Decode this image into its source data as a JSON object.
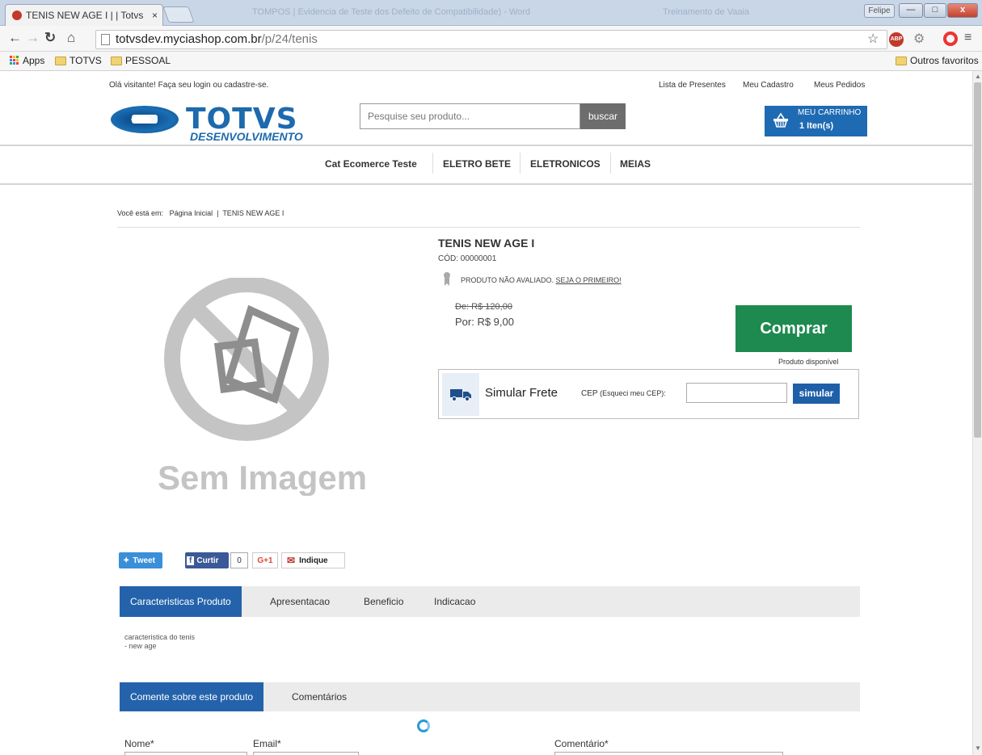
{
  "browser": {
    "tab_title": "TENIS NEW AGE I | | Totvs",
    "tab_close": "×",
    "bg_title_1": "TOMPOS | Evidencia de Teste dos Defeito de Compatibilidade) - Word",
    "bg_title_2": "Treinamento de Vaaia",
    "user_badge": "Felipe",
    "url_host": "totvsdev.myciashop.com.br",
    "url_path": "/p/24/tenis",
    "abp": "ABP"
  },
  "bookmarks": {
    "apps": "Apps",
    "items": [
      "TOTVS",
      "PESSOAL"
    ],
    "others": "Outros favoritos"
  },
  "header": {
    "welcome": "Olá visitante! Faça seu login ou cadastre-se.",
    "links": [
      "Lista de Presentes",
      "Meu Cadastro",
      "Meus Pedidos"
    ],
    "logo_text": "TOTVS",
    "logo_sub": "DESENVOLVIMENTO",
    "search_placeholder": "Pesquise seu produto...",
    "search_button": "buscar",
    "cart_label": "MEU CARRINHO",
    "cart_count": "1 Iten(s)"
  },
  "nav": {
    "items": [
      "Cat Ecomerce Teste",
      "ELETRO BETE",
      "ELETRONICOS",
      "MEIAS"
    ]
  },
  "breadcrumb": {
    "prefix": "Você está em:",
    "home": "Página Inicial",
    "sep": "|",
    "current": "TENIS NEW AGE I"
  },
  "product": {
    "image_text": "Sem Imagem",
    "title": "TENIS NEW AGE I",
    "code": "CÓD: 00000001",
    "rating_text": "PRODUTO NÃO AVALIADO.",
    "rating_link": "SEJA O PRIMEIRO!",
    "price_old": "De: R$ 120,00",
    "price_new": "Por: R$ 9,00",
    "buy_button": "Comprar",
    "availability": "Produto disponível"
  },
  "shipping": {
    "title": "Simular Frete",
    "cep_label": "CEP",
    "cep_help": "(Esqueci meu CEP):",
    "button": "simular"
  },
  "social": {
    "tweet": "Tweet",
    "curtir": "Curtir",
    "count": "0",
    "gplus": "G+1",
    "indique": "Indique"
  },
  "tabs": {
    "items": [
      "Caracteristicas Produto",
      "Apresentacao",
      "Beneficio",
      "Indicacao"
    ],
    "content_line1": "caracteristica do tenis",
    "content_line2": "- new age"
  },
  "comments": {
    "tabs": [
      "Comente sobre este produto",
      "Comentários"
    ],
    "labels": [
      "Nome*",
      "Email*",
      "Comentário*"
    ]
  },
  "colors": {
    "brand_blue": "#1d6aad",
    "buy_green": "#1e8a4f",
    "tab_blue": "#2463ab"
  }
}
